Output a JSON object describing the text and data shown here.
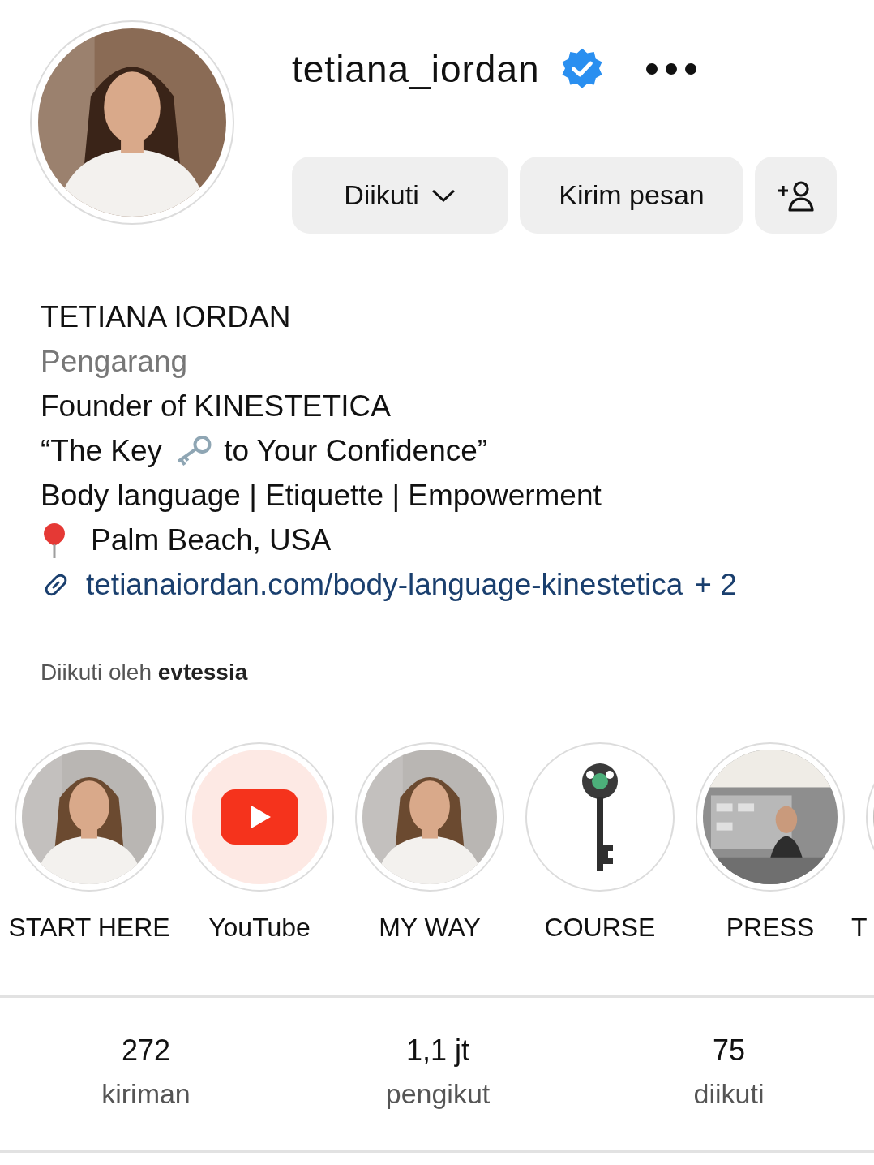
{
  "profile": {
    "username": "tetiana_iordan",
    "verified": true
  },
  "buttons": [
    {
      "kind": "dropdown",
      "label": "Diikuti"
    },
    {
      "kind": "text",
      "label": "Kirim pesan"
    },
    {
      "kind": "add_person"
    }
  ],
  "bio": [
    {
      "kind": "name",
      "text": "TETIANA IORDAN"
    },
    {
      "kind": "category",
      "text": "Pengarang"
    },
    {
      "kind": "text",
      "text": "Founder of KINESTETICA"
    },
    {
      "kind": "key",
      "before": "“The Key",
      "after": "to Your Confidence”"
    },
    {
      "kind": "text",
      "text": "Body language | Etiquette | Empowerment"
    },
    {
      "kind": "location",
      "text": "Palm Beach, USA"
    },
    {
      "kind": "link",
      "text": "tetianaiordan.com/body-language-kinestetica",
      "more": "+ 2"
    }
  ],
  "followed_by": "Diikuti oleh **evtessia**",
  "highlights": [
    {
      "label": "START HERE"
    },
    {
      "label": "YouTube",
      "kind": "youtube"
    },
    {
      "label": "MY WAY"
    },
    {
      "label": "COURSE",
      "kind": "key"
    },
    {
      "label": "PRESS",
      "kind": "press"
    },
    {
      "label": "T"
    }
  ],
  "stats": [
    {
      "value": "272",
      "label": "kiriman"
    },
    {
      "value": "1,1 jt",
      "label": "pengikut"
    },
    {
      "value": "75",
      "label": "diikuti"
    }
  ]
}
